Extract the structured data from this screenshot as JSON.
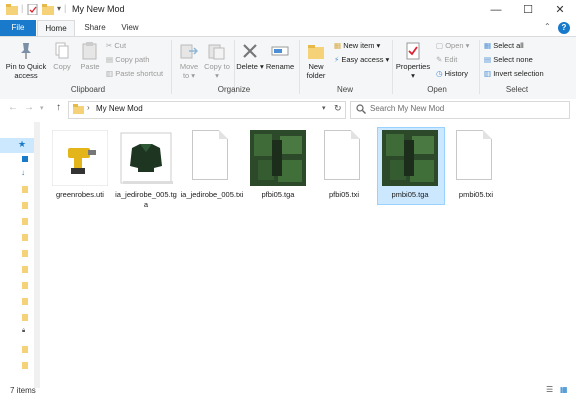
{
  "window": {
    "title": "My New Mod",
    "minimize": "—",
    "maximize": "☐",
    "close": "✕"
  },
  "ribbon_tabs": [
    "File",
    "Home",
    "Share",
    "View"
  ],
  "help": "?",
  "collapse": "⌃",
  "clipboard": {
    "pin_to_quick_access": "Pin to Quick access",
    "copy": "Copy",
    "paste": "Paste",
    "cut": "Cut",
    "copy_path": "Copy path",
    "paste_shortcut": "Paste shortcut",
    "label": "Clipboard"
  },
  "organize": {
    "move_to": "Move to ▾",
    "copy_to": "Copy to ▾",
    "delete": "Delete ▾",
    "rename": "Rename",
    "label": "Organize"
  },
  "new": {
    "new_folder": "New folder",
    "new_item": "New item ▾",
    "easy_access": "Easy access ▾",
    "label": "New"
  },
  "open": {
    "properties": "Properties ▾",
    "open": "Open ▾",
    "edit": "Edit",
    "history": "History",
    "label": "Open"
  },
  "select": {
    "select_all": "Select all",
    "select_none": "Select none",
    "invert_selection": "Invert selection",
    "label": "Select"
  },
  "address": {
    "path": "My New Mod",
    "search_placeholder": "Search My New Mod"
  },
  "files": [
    {
      "name": "greenrobes.uti",
      "icon": "drill-icon",
      "selected": false
    },
    {
      "name": "ia_jedirobe_005.tga",
      "icon": "robe-thumbnail",
      "selected": false
    },
    {
      "name": "ia_jedirobe_005.txi",
      "icon": "document-icon",
      "selected": false
    },
    {
      "name": "pfbi05.tga",
      "icon": "texture-thumbnail",
      "selected": false
    },
    {
      "name": "pfbi05.txi",
      "icon": "document-icon",
      "selected": false
    },
    {
      "name": "pmbi05.tga",
      "icon": "texture-thumbnail",
      "selected": true
    },
    {
      "name": "pmbi05.txi",
      "icon": "document-icon",
      "selected": false
    }
  ],
  "status": {
    "item_count": "7 items"
  },
  "colors": {
    "accent": "#1979ca",
    "selection": "#cce8ff",
    "folder": "#f5d278"
  }
}
